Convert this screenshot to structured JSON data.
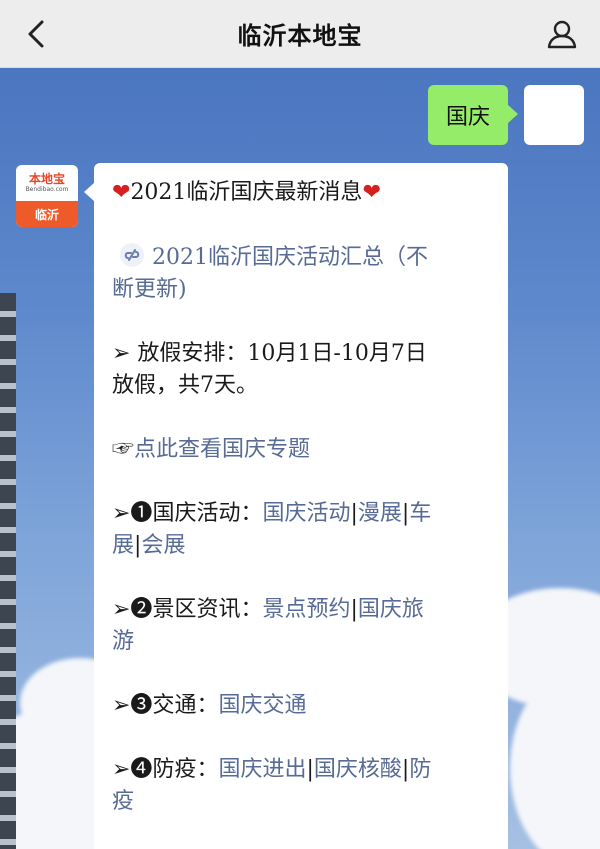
{
  "navbar": {
    "back_icon": "chevron-left-icon",
    "title": "临沂本地宝",
    "profile_icon": "user-profile-icon"
  },
  "user_message": {
    "text": "国庆"
  },
  "bot_avatar": {
    "brand": "本地宝",
    "domain": "Bendibao.com",
    "city": "临沂"
  },
  "reply": {
    "heading": {
      "heart_left": "❤",
      "text": "2021临沂国庆最新消息",
      "heart_right": "❤"
    },
    "activity_link": {
      "icon": "mini-program-link-icon",
      "line1": "2021临沂国庆活动汇总（不",
      "line2": "断更新)"
    },
    "holiday": {
      "line1": "➢ 放假安排：10月1日-10月7日",
      "line2": "放假，共7天。"
    },
    "topic": {
      "pointer": "☞",
      "link": "点此查看国庆专题"
    },
    "sections": [
      {
        "marker": "➢❶",
        "label": "国庆活动：",
        "links_line1": [
          "国庆活动",
          "漫展",
          "车"
        ],
        "links_line2": [
          "展",
          "会展"
        ]
      },
      {
        "marker": "➢❷",
        "label": "景区资讯：",
        "links_line1": [
          "景点预约",
          "国庆旅"
        ],
        "links_line2": [
          "游"
        ]
      },
      {
        "marker": "➢❸",
        "label": "交通：",
        "links_line1": [
          "国庆交通"
        ]
      },
      {
        "marker": "➢❹",
        "label": "防疫：",
        "links_line1": [
          "国庆进出",
          "国庆核酸",
          "防"
        ],
        "links_line2": [
          "疫"
        ]
      }
    ],
    "separator": "|"
  },
  "colors": {
    "navbar_bg": "#ededed",
    "user_bubble": "#95ec69",
    "link": "#576b95",
    "heart": "#d62020",
    "brand_orange": "#ef5a2a"
  }
}
